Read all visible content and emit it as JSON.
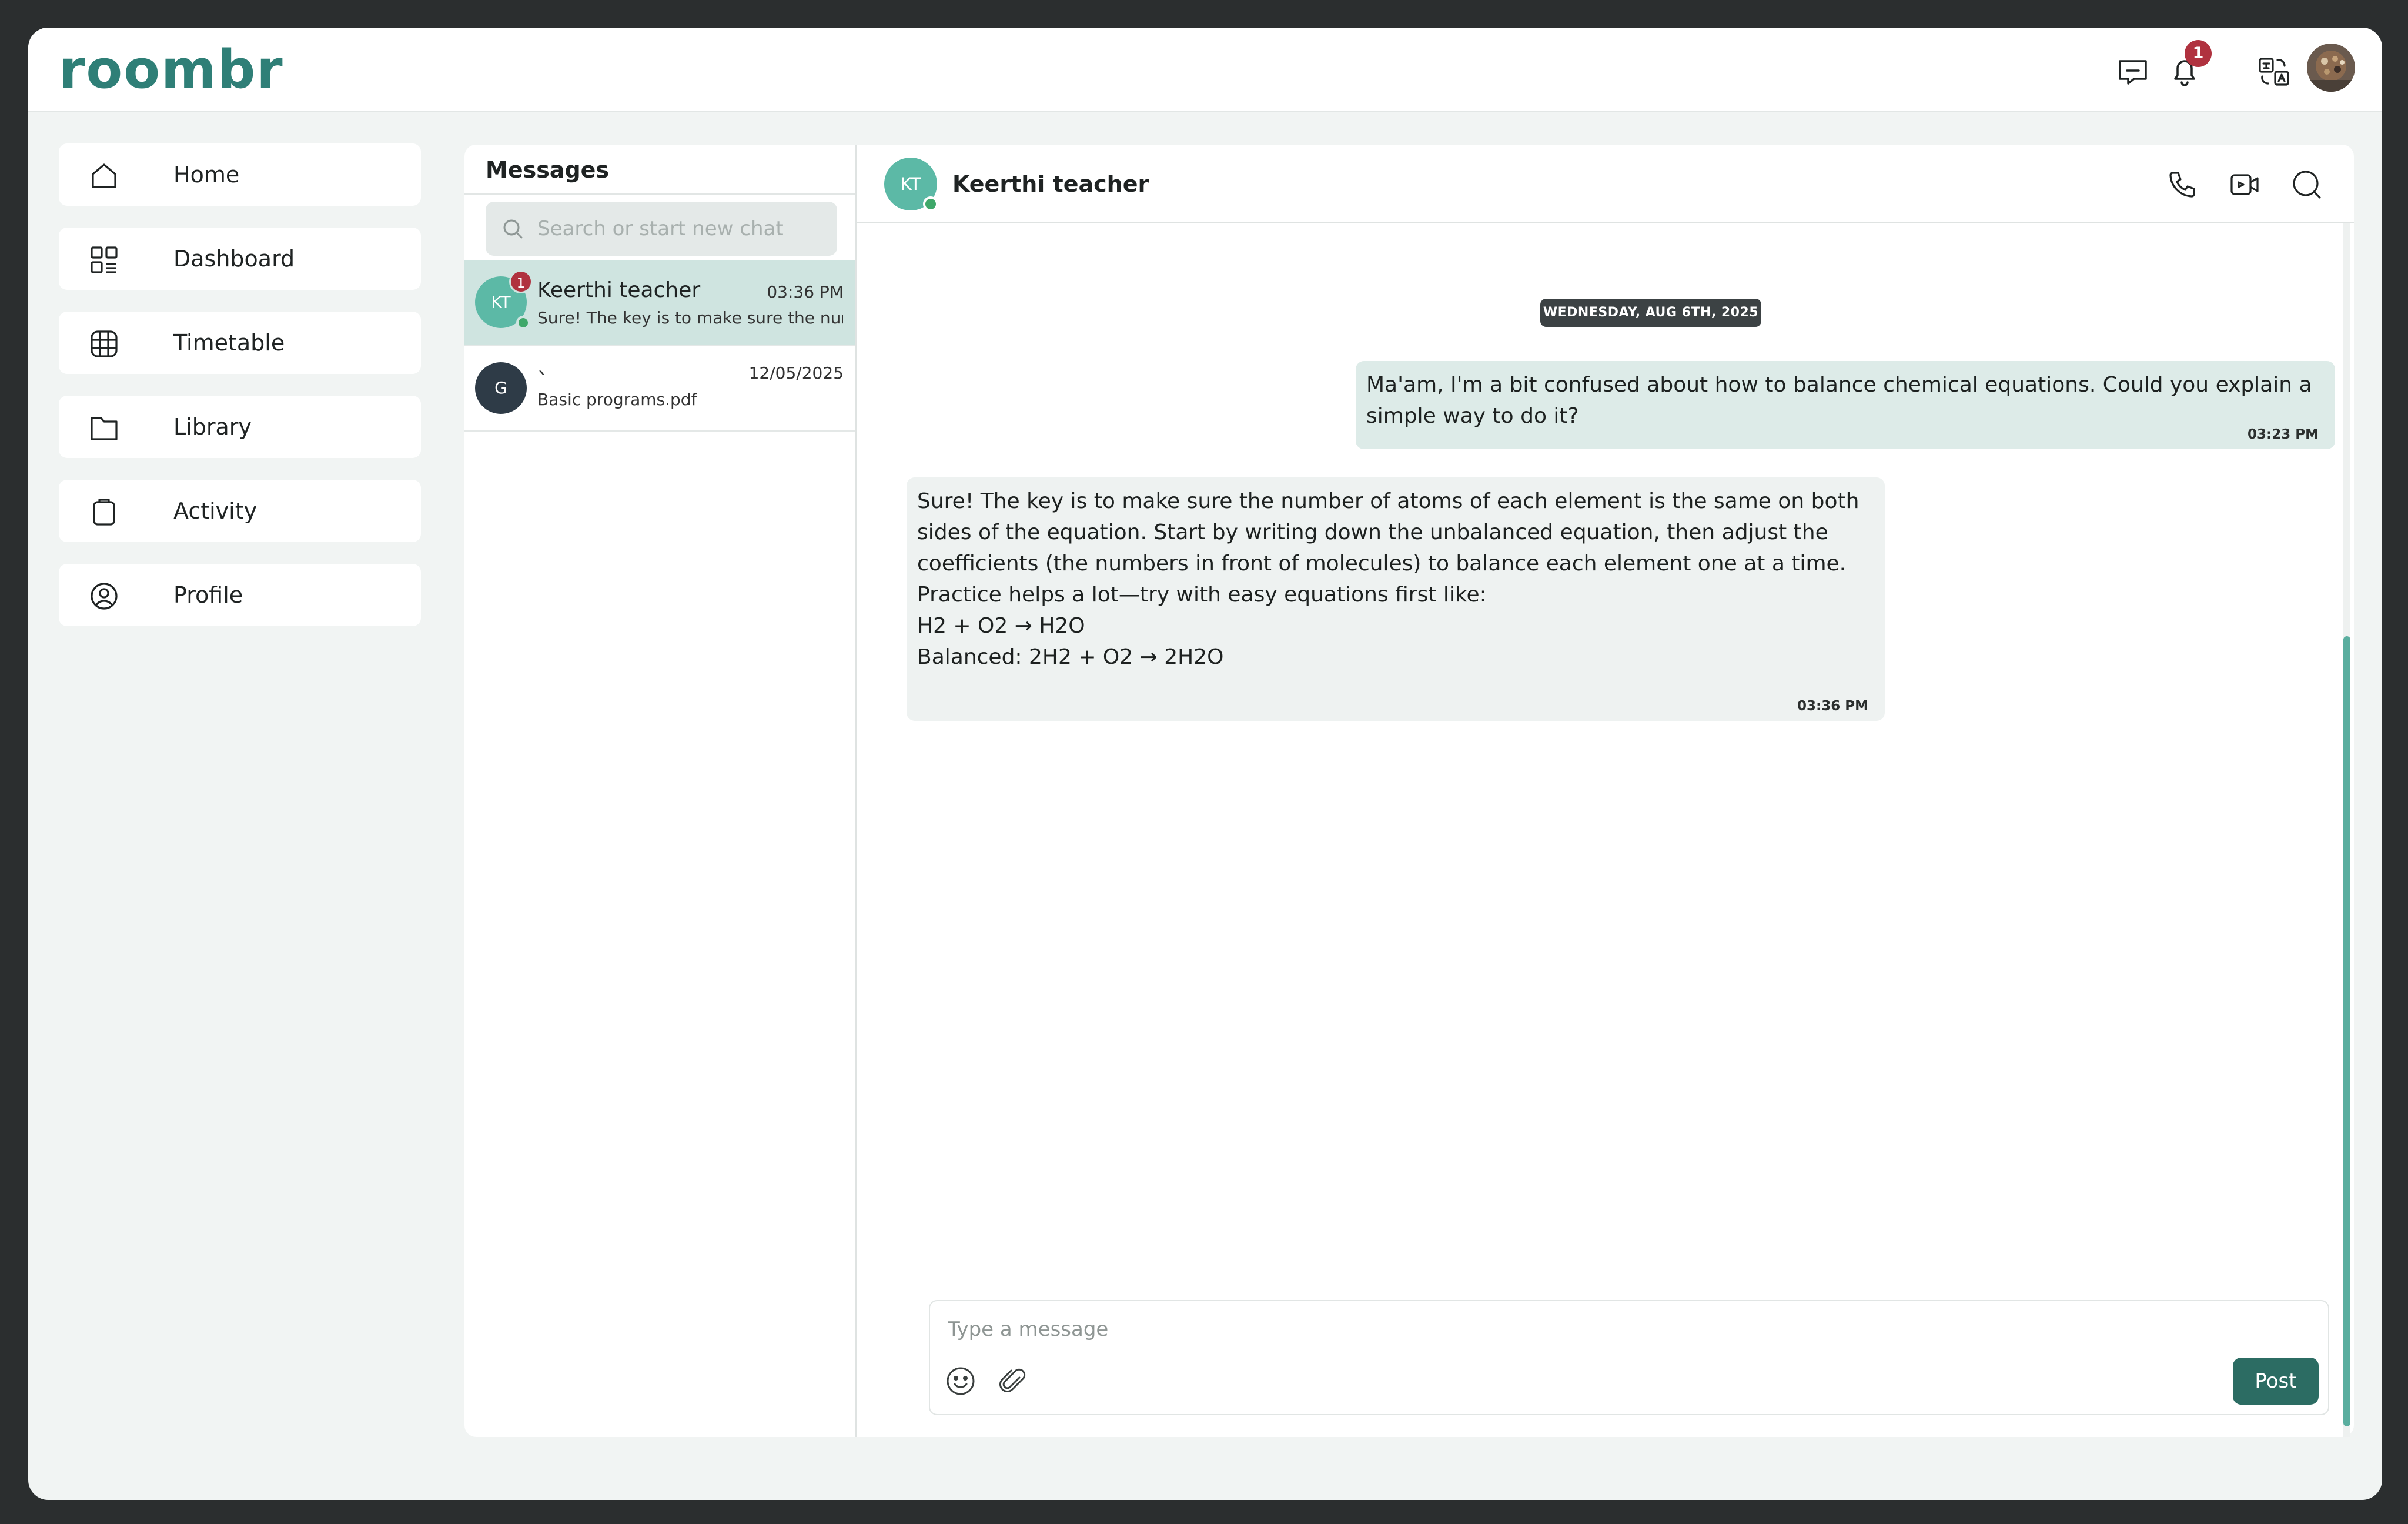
{
  "app": {
    "logo_text": "roombr",
    "accent_color": "#2f7f77",
    "notification_count": "1"
  },
  "topbar_icons": [
    "chat-bubble-icon",
    "bell-icon",
    "translate-icon"
  ],
  "sidebar": {
    "items": [
      {
        "label": "Home",
        "icon": "home-icon"
      },
      {
        "label": "Dashboard",
        "icon": "dashboard-icon"
      },
      {
        "label": "Timetable",
        "icon": "globe-grid-icon"
      },
      {
        "label": "Library",
        "icon": "folder-icon"
      },
      {
        "label": "Activity",
        "icon": "clipboard-icon"
      },
      {
        "label": "Profile",
        "icon": "user-circle-icon"
      }
    ]
  },
  "messages_panel": {
    "title": "Messages",
    "search_placeholder": "Search or start new chat",
    "conversations": [
      {
        "initials": "KT",
        "name": "Keerthi teacher",
        "time": "03:36 PM",
        "preview": "Sure! The key is to make sure the numb",
        "unread": "1",
        "online": true,
        "active": true,
        "avatar_color": "#5cb9a6"
      },
      {
        "initials": "G",
        "name": "`",
        "time": "12/05/2025",
        "preview": "Basic programs.pdf",
        "active": false,
        "avatar_color": "#2e3b47"
      }
    ]
  },
  "chat": {
    "initials": "KT",
    "name": "Keerthi teacher",
    "date_separator": "WEDNESDAY, AUG 6TH, 2025",
    "messages": [
      {
        "direction": "sent",
        "lines": [
          "Ma'am, I'm a bit confused about how to balance chemical equations. Could you explain a",
          "simple way to do it?"
        ],
        "time": "03:23 PM"
      },
      {
        "direction": "received",
        "lines": [
          "Sure! The key is to make sure the number of atoms of each element is the same on both",
          "sides of the equation. Start by writing down the unbalanced equation, then adjust the",
          "coefficients (the numbers in front of molecules) to balance each element one at a time.",
          "Practice helps a lot—try with easy equations first like:",
          "H2 + O2 → H2O",
          "Balanced: 2H2 + O2 → 2H2O"
        ],
        "time": "03:36 PM"
      }
    ],
    "composer": {
      "placeholder": "Type a message",
      "post_label": "Post"
    }
  }
}
